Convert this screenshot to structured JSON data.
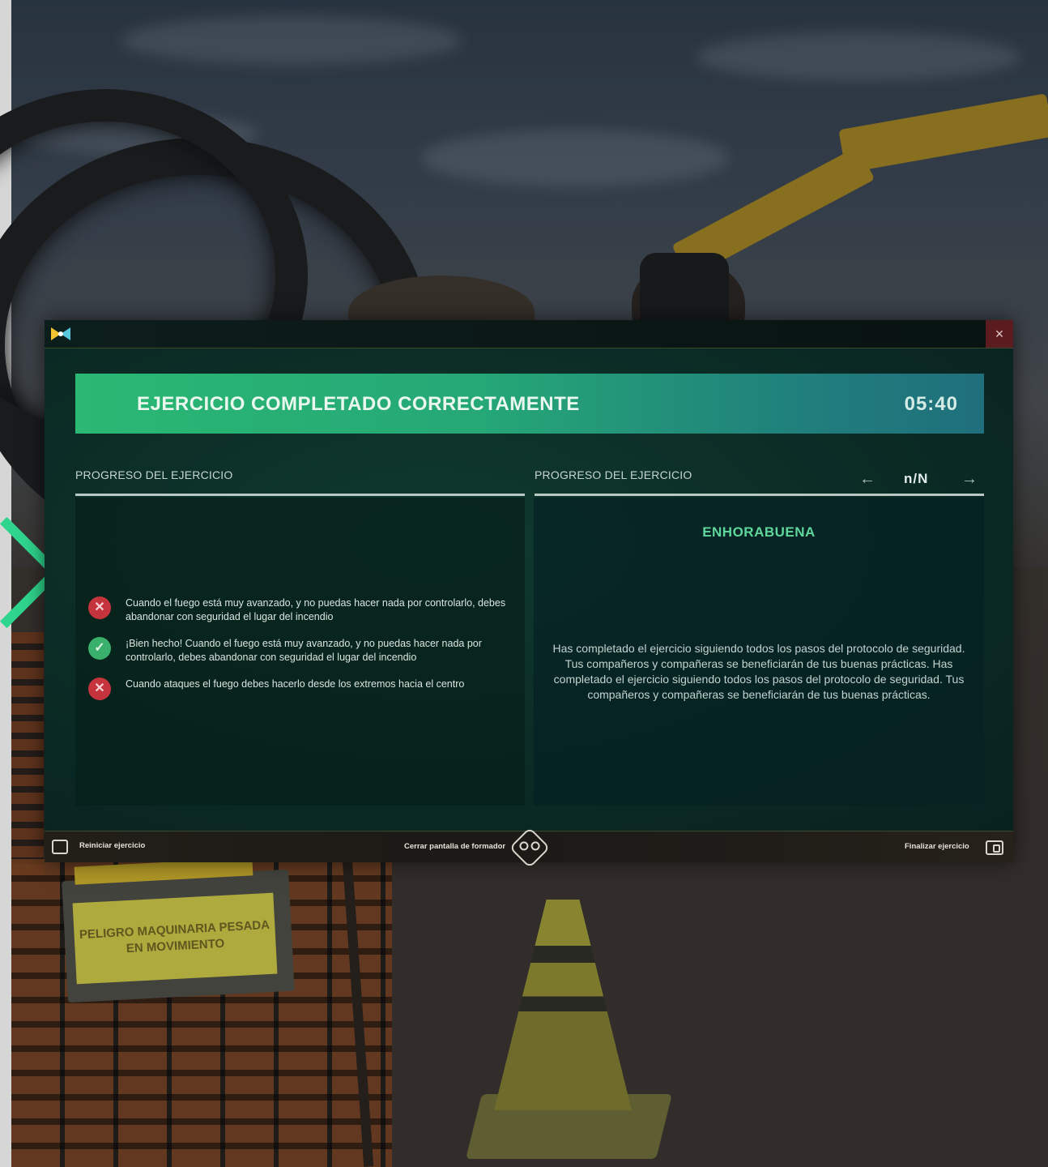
{
  "background": {
    "sign_text": "PELIGRO MAQUINARIA PESADA EN MOVIMIENTO"
  },
  "window": {
    "logo_icon": "bowtie-logo-icon",
    "close_label": "×"
  },
  "banner": {
    "title": "EJERCICIO COMPLETADO CORRECTAMENTE",
    "time": "05:40",
    "color_start": "#2ab873",
    "color_end": "#1f6f7c"
  },
  "left_panel": {
    "heading": "PROGRESO DEL EJERCICIO",
    "items": [
      {
        "status": "wrong",
        "icon": "x-circle-icon",
        "glyph": "✕",
        "text": "Cuando el fuego está muy avanzado, y no puedas hacer nada por controlarlo, debes abandonar con seguridad el lugar del incendio"
      },
      {
        "status": "right",
        "icon": "check-circle-icon",
        "glyph": "✓",
        "text": "¡Bien hecho! Cuando el fuego está muy avanzado, y no puedas hacer nada por controlarlo, debes abandonar con seguridad el lugar del incendio"
      },
      {
        "status": "wrong",
        "icon": "x-circle-icon",
        "glyph": "✕",
        "text": "Cuando ataques el fuego debes hacerlo desde los extremos hacia el centro"
      }
    ]
  },
  "right_panel": {
    "heading": "PROGRESO DEL EJERCICIO",
    "pager": {
      "prev": "←",
      "count": "n/N",
      "next": "→"
    },
    "title": "ENHORABUENA",
    "body": "Has completado el ejercicio siguiendo todos los pasos del protocolo de seguridad. Tus compañeros y compañeras se beneficiarán de tus buenas prácticas. Has completado el ejercicio siguiendo todos los pasos del protocolo de seguridad. Tus compañeros y compañeras se beneficiarán de tus buenas prácticas."
  },
  "footer": {
    "restart_label": "Reiniciar ejercicio",
    "close_screen_label": "Cerrar pantalla de formador",
    "finish_label": "Finalizar ejercicio"
  },
  "colors": {
    "accent_green": "#2fd58d",
    "wrong_red": "#c5333c",
    "right_green": "#39b06b",
    "congrats_green": "#5fd79c"
  }
}
